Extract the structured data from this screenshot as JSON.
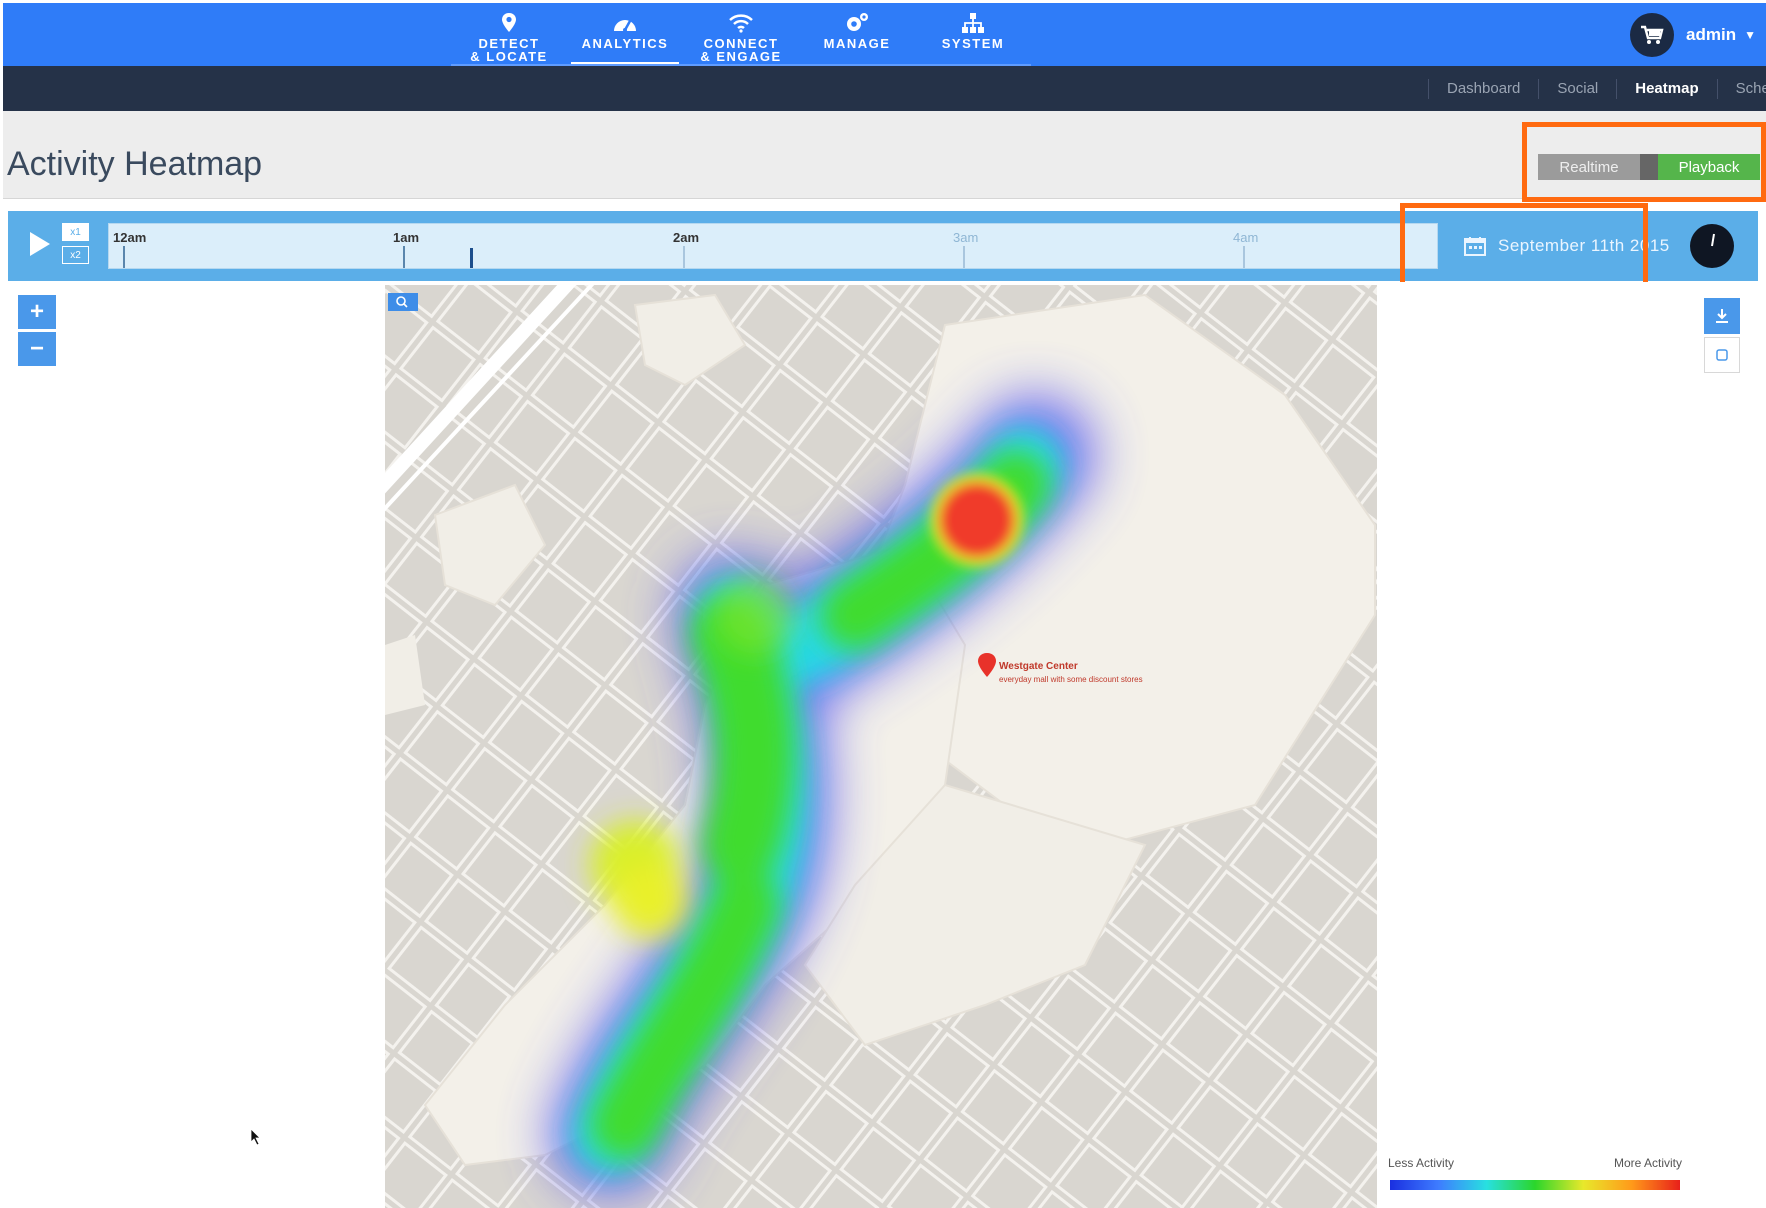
{
  "nav": {
    "items": [
      {
        "label": "DETECT\n& LOCATE",
        "icon": "location-pin-icon"
      },
      {
        "label": "ANALYTICS",
        "icon": "dashboard-gauge-icon"
      },
      {
        "label": "CONNECT\n& ENGAGE",
        "icon": "wifi-icon"
      },
      {
        "label": "MANAGE",
        "icon": "gears-icon"
      },
      {
        "label": "SYSTEM",
        "icon": "hierarchy-icon"
      }
    ],
    "active": "ANALYTICS",
    "user": {
      "name": "admin",
      "icon": "cart-avatar-icon"
    }
  },
  "subnav": {
    "items": [
      {
        "label": "Dashboard"
      },
      {
        "label": "Social"
      },
      {
        "label": "Heatmap"
      },
      {
        "label": "Schedu"
      }
    ],
    "active": "Heatmap"
  },
  "header": {
    "title": "Activity Heatmap",
    "mode_realtime": "Realtime",
    "mode_playback": "Playback",
    "selected_mode": "Playback"
  },
  "timeline": {
    "speed_options": [
      "x1",
      "x2"
    ],
    "ticks": [
      {
        "label": "12am"
      },
      {
        "label": "1am"
      },
      {
        "label": "2am"
      },
      {
        "label": "3am"
      },
      {
        "label": "4am"
      }
    ],
    "date": "September 11th 2015"
  },
  "map": {
    "zoom_in": "+",
    "zoom_out": "−",
    "labels": {
      "westgate": "Westgate Center",
      "westgate_sub": "everyday mall with some discount stores"
    }
  },
  "legend": {
    "less": "Less Activity",
    "more": "More Activity"
  },
  "colors": {
    "nav_bg": "#2f7cf8",
    "subnav_bg": "#253248",
    "playback_green": "#55b54b",
    "highlight_orange": "#ff6a10",
    "timeline_blue": "#5baee8"
  }
}
